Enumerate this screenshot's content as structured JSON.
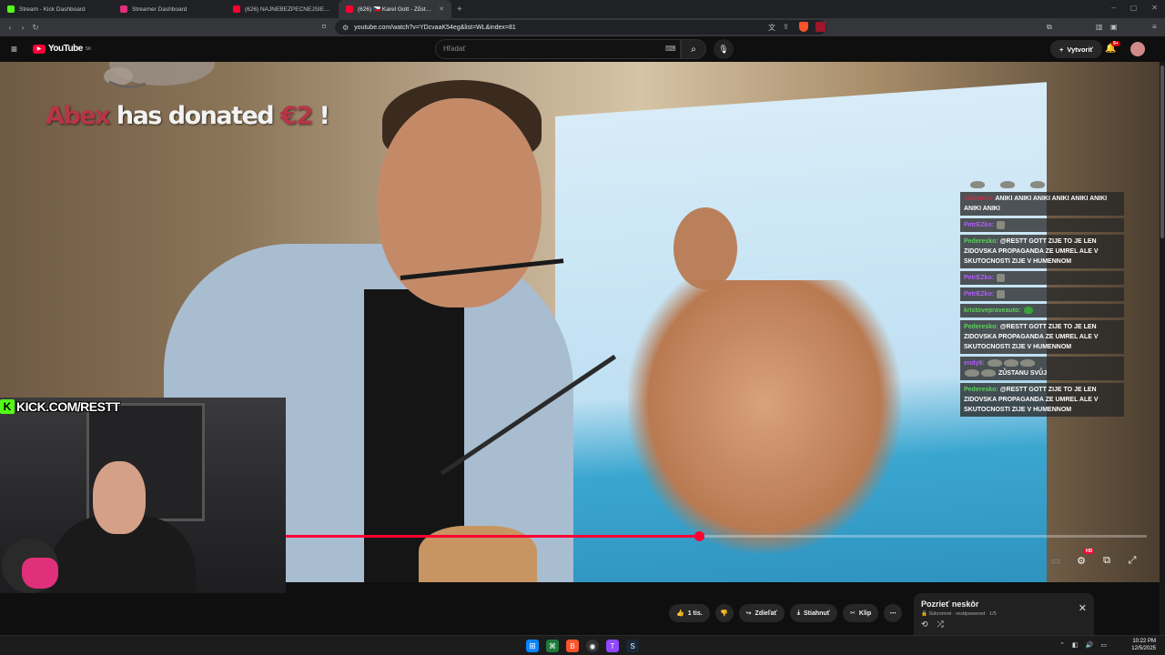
{
  "browser": {
    "tabs": [
      {
        "label": "Stream - Kick Dashboard",
        "favicon_color": "#53fc18",
        "active": false
      },
      {
        "label": "Streamer Dashboard",
        "favicon_color": "#e0307a",
        "active": false
      },
      {
        "label": "(626) NAJNEBEZPEČNEJŠIE ULICE AR...",
        "favicon_color": "#ff0033",
        "active": false
      },
      {
        "label": "(626) 🇨🇿 Karel Gott - Zůstanu...",
        "favicon_color": "#ff0033",
        "active": true
      }
    ],
    "url": "youtube.com/watch?v=YDcvaaK54eg&list=WL&index=81"
  },
  "youtube": {
    "logo_text": "YouTube",
    "logo_region": "SK",
    "search_placeholder": "Hľadať",
    "create_label": "Vytvoriť",
    "notif_count": "9+"
  },
  "overlay": {
    "donation": {
      "name": "Abex",
      "middle": " has donated ",
      "amount": "€2",
      "end": " !"
    },
    "kick_url": "KICK.COM/RESTT",
    "chat": [
      {
        "user": "Akbatros:",
        "text": "ANIKI  ANIKI  ANIKI  ANIKI  ANIKI  ANIKI  ANIKI  ANIKI",
        "color": "#b83548"
      },
      {
        "user": "PetrEZko:",
        "text": "",
        "color": "#b15cff"
      },
      {
        "user": "Pederesko:",
        "text": "@RESTT GOTT ZIJE TO JE LEN ZIDOVSKA PROPAGANDA ZE UMREL ALE V SKUTOCNOSTI ZIJE V HUMENNOM",
        "color": "#5bd15b"
      },
      {
        "user": "PetrEZko:",
        "text": "",
        "color": "#b15cff"
      },
      {
        "user": "PetrEZko:",
        "text": "",
        "color": "#b15cff"
      },
      {
        "user": "kristovepraveauto:",
        "text": "",
        "color": "#5bd15b"
      },
      {
        "user": "Pederesko:",
        "text": "@RESTT GOTT ZIJE TO JE LEN ZIDOVSKA PROPAGANDA ZE UMREL ALE V SKUTOCNOSTI ZIJE V HUMENNOM",
        "color": "#5bd15b"
      },
      {
        "user": "endy9:",
        "text": "ZŮSTANU SVŮJ",
        "color": "#b15cff"
      },
      {
        "user": "Pederesko:",
        "text": "@RESTT GOTT ZIJE TO JE LEN ZIDOVSKA PROPAGANDA ZE UMREL ALE V SKUTOCNOSTI ZIJE V HUMENNOM",
        "color": "#5bd15b"
      }
    ]
  },
  "player": {
    "progress_fraction": 0.48
  },
  "actions": {
    "like_count": "1 tis.",
    "share_label": "Zdieľať",
    "download_label": "Stiahnuť",
    "clip_label": "Klip"
  },
  "popup": {
    "title": "Pozrieť neskôr",
    "subtitle": "Súkromné · resttpowered · 1/5"
  },
  "taskbar": {
    "time": "10:22 PM",
    "date": "12/5/2025"
  }
}
